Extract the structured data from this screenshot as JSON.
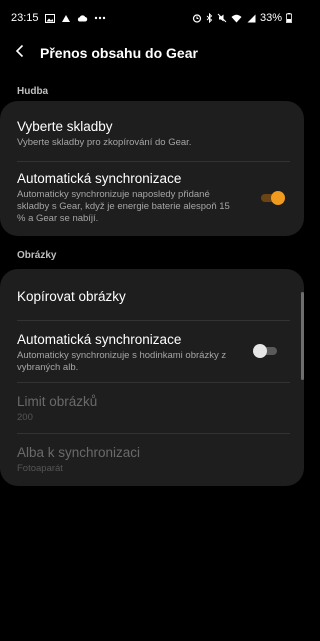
{
  "status_bar": {
    "time": "23:15",
    "battery": "33%",
    "left_icons": [
      "gallery-icon",
      "voicemail-icon",
      "cloud-icon",
      "more-dots-icon"
    ],
    "right_icons": [
      "alarm-icon",
      "bluetooth-icon",
      "mute-icon",
      "wifi-icon",
      "signal-icon",
      "battery-icon"
    ]
  },
  "header": {
    "title": "Přenos obsahu do Gear"
  },
  "music_section": {
    "label": "Hudba",
    "items": [
      {
        "title": "Vyberte skladby",
        "subtitle": "Vyberte skladby pro zkopírování do Gear."
      },
      {
        "title": "Automatická synchronizace",
        "subtitle": "Automaticky synchronizuje naposledy přidané skladby s Gear, když je energie baterie alespoň 15 % a Gear se nabíjí.",
        "toggle": true
      }
    ]
  },
  "images_section": {
    "label": "Obrázky",
    "items": [
      {
        "title": "Kopírovat obrázky"
      },
      {
        "title": "Automatická synchronizace",
        "subtitle": "Automaticky synchronizuje s hodinkami obrázky z vybraných alb.",
        "toggle": false
      },
      {
        "title": "Limit obrázků",
        "subtitle": "200",
        "disabled": true
      },
      {
        "title": "Alba k synchronizaci",
        "subtitle": "Fotoaparát",
        "disabled": true
      }
    ]
  },
  "colors": {
    "accent": "#f09a1e",
    "background": "#000000",
    "card": "#1e1e1e"
  }
}
